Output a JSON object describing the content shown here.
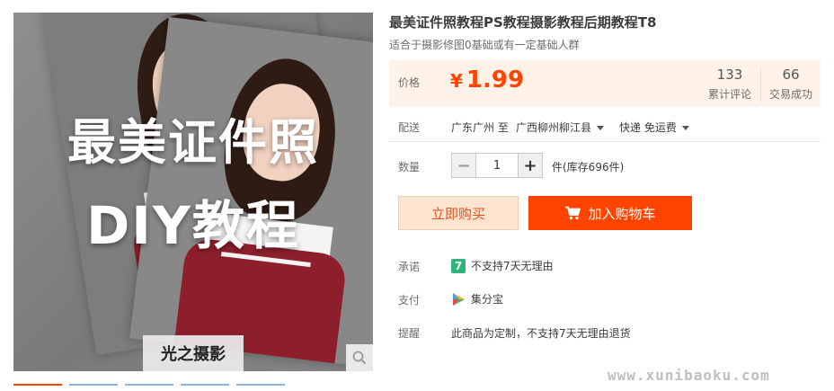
{
  "gallery": {
    "image_title_line1": "最美证件照",
    "image_title_line2": "DIY教程",
    "image_badge": "光之摄影",
    "zoom_icon": "search-icon"
  },
  "product": {
    "title": "最美证件照教程PS教程摄影教程后期教程T8",
    "subtitle": "适合于摄影修图0基础或有一定基础人群"
  },
  "price": {
    "label": "价格",
    "currency": "¥",
    "value": "1.99",
    "reviews_count": "133",
    "reviews_label": "累计评论",
    "deals_count": "66",
    "deals_label": "交易成功"
  },
  "delivery": {
    "label": "配送",
    "from": "广东广州 至",
    "to": "广西柳州柳江县",
    "shipping": "快递 免运费"
  },
  "quantity": {
    "label": "数量",
    "minus": "−",
    "value": "1",
    "plus": "+",
    "stock": "件(库存696件)"
  },
  "actions": {
    "buy_now": "立即购买",
    "add_to_cart": "加入购物车"
  },
  "promise": {
    "label": "承诺",
    "badge": "7",
    "text": "不支持7天无理由"
  },
  "payment": {
    "label": "支付",
    "text": "集分宝"
  },
  "reminder": {
    "label": "提醒",
    "text": "此商品为定制，不支持7天无理由退货"
  },
  "watermark": "www.xunibaoku.com",
  "colors": {
    "accent": "#ff4400",
    "price_bg": "#fff2e8",
    "promise_icon": "#2fb47d"
  }
}
